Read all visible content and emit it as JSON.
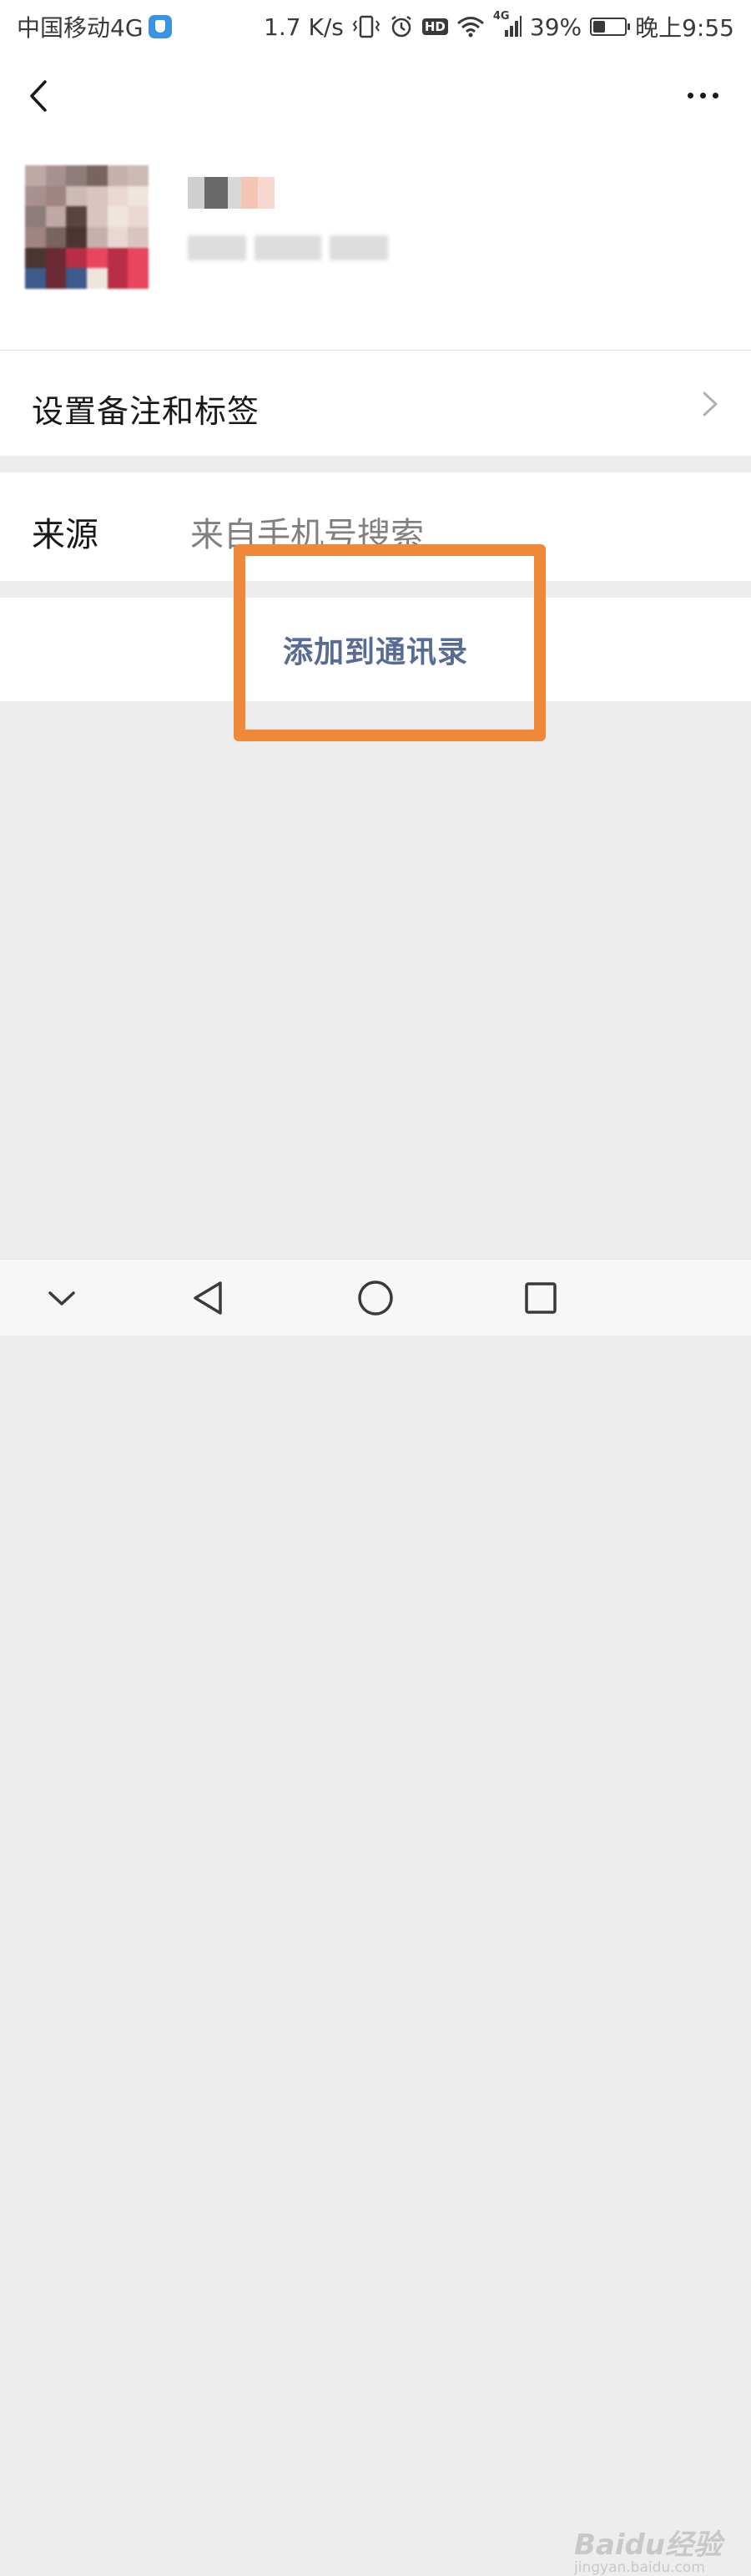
{
  "status_bar": {
    "carrier": "中国移动4G",
    "speed": "1.7 K/s",
    "hd": "HD",
    "network": "4G",
    "battery": "39%",
    "battery_level": 0.39,
    "time": "晚上9:55"
  },
  "header": {
    "back_icon": "chevron-left-icon",
    "more_icon": "more-dots-icon"
  },
  "rows": {
    "remark_label": "设置备注和标签",
    "source_label": "来源",
    "source_value": "来自手机号搜索",
    "add_contact": "添加到通讯录"
  },
  "colors": {
    "link": "#576b95",
    "highlight": "#f0883a",
    "page_bg": "#ededed"
  },
  "watermark": {
    "main": "Baidu经验",
    "sub": "jingyan.baidu.com"
  }
}
